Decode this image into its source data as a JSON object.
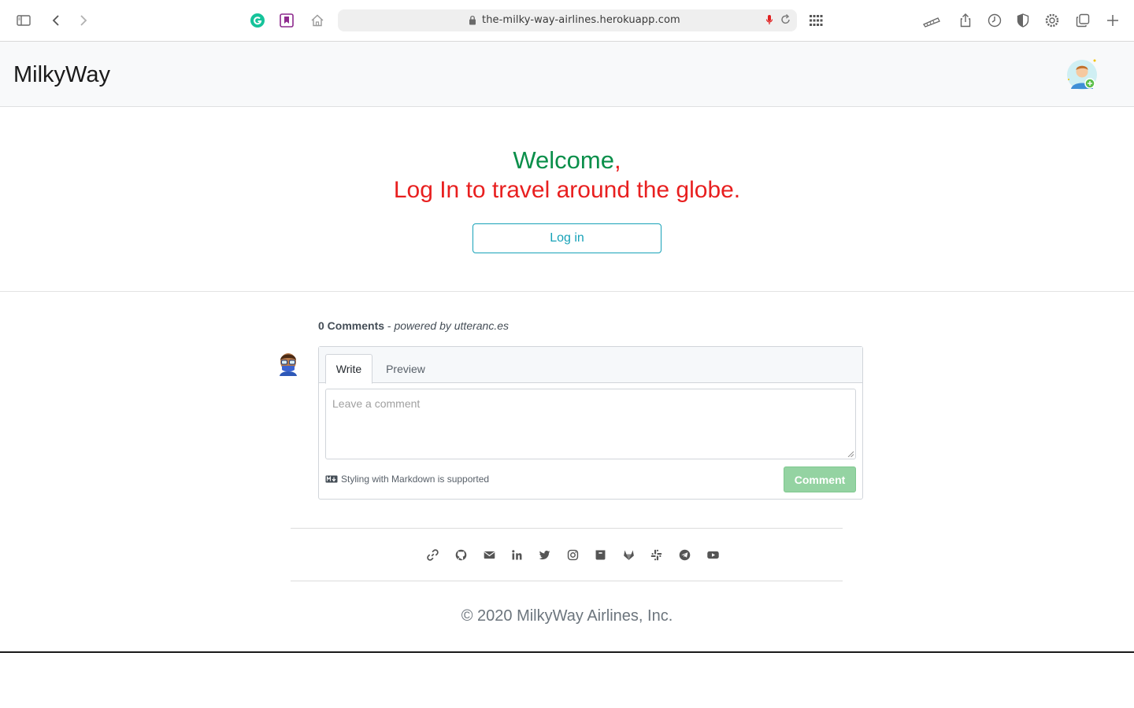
{
  "browser": {
    "url": "the-milky-way-airlines.herokuapp.com"
  },
  "navbar": {
    "brand": "MilkyWay"
  },
  "hero": {
    "welcome": "Welcome",
    "comma": ",",
    "tagline": "Log In to travel around the globe.",
    "login_label": "Log in",
    "colors": {
      "welcome": "#0a8f4a",
      "tagline": "#e81f1f",
      "button": "#17a2b8"
    }
  },
  "comments": {
    "count_label": "0 Comments",
    "separator": " - ",
    "powered_by": "powered by utteranc.es",
    "tabs": [
      "Write",
      "Preview"
    ],
    "placeholder": "Leave a comment",
    "markdown_note": "Styling with Markdown is supported",
    "comment_label": "Comment"
  },
  "footer": {
    "social_icons": [
      "link-icon",
      "github-icon",
      "email-icon",
      "linkedin-icon",
      "twitter-icon",
      "instagram-icon",
      "archive-icon",
      "gitlab-icon",
      "slack-icon",
      "telegram-icon",
      "youtube-icon"
    ],
    "copyright": "© 2020 MilkyWay Airlines, Inc."
  }
}
